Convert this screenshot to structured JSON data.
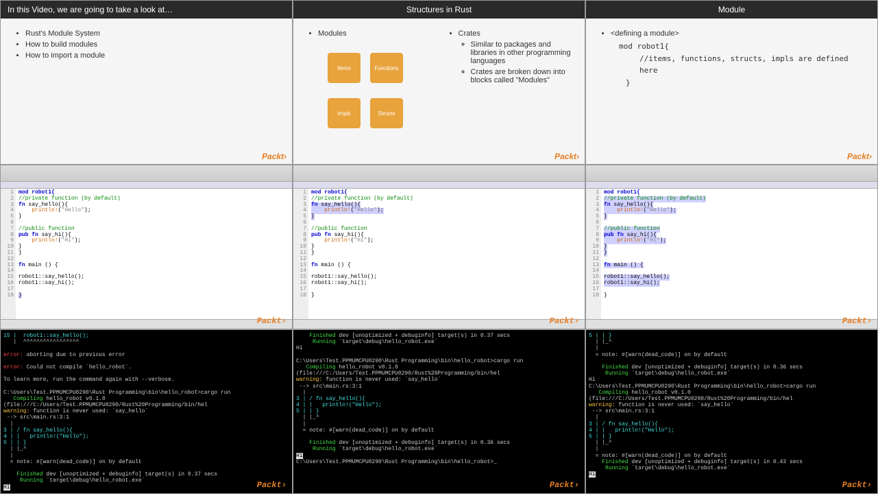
{
  "brand": "Packt›",
  "slide1": {
    "title": "In this Video, we are going to take a look at…",
    "items": [
      "Rust's Module System",
      "How to build modules",
      "How to import a module"
    ]
  },
  "slide2": {
    "title": "Structures in Rust",
    "col1_title": "Modules",
    "boxes": {
      "items": "Items",
      "functions": "Functions",
      "impls": "Impls",
      "structs": "Structs"
    },
    "col2_title": "Crates",
    "crates": [
      "Similar to packages and libraries in other programming languages",
      "Crates are broken down into blocks called \"Modules\""
    ]
  },
  "slide3": {
    "title": "Module",
    "heading": "<defining a module>",
    "line1": "mod robot1{",
    "line2": "//items, functions, structs, impls are defined here",
    "line3": "}"
  },
  "editor_gutter": "1\n2\n3\n4\n5\n6\n7\n8\n9\n10\n11\n12\n13\n14\n15\n16\n17\n18",
  "editor_code": {
    "l1": "mod robot1{",
    "l2": "//private function (by default)",
    "l3": "fn say_hello(){",
    "l4": "    println!(\"Hello\");",
    "l5": "}",
    "l6": "",
    "l7": "//public function",
    "l8": "pub fn say_hi(){",
    "l9": "    println!(\"Hi\");",
    "l10": "}",
    "l11": "}",
    "l12": "",
    "l13": "fn main () {",
    "l14": "",
    "l15": "robot1::say_hello();",
    "l16": "robot1::say_hi();",
    "l17": "",
    "l18": "}"
  },
  "terminal1": {
    "l1": "15 |  robot1::say_hello();",
    "l2": "   |  ^^^^^^^^^^^^^^^^^",
    "l3": "error: aborting due to previous error",
    "l4": "error: Could not compile `hello_robot`.",
    "l5": "To learn more, run the command again with --verbose.",
    "l6": "C:\\Users\\Test.PPMUMCPU0290\\Rust Programming\\bin\\hello_robot>cargo run",
    "l7": "   Compiling hello_robot v0.1.0 (file:///C:/Users/Test.PPMUMCPU0290/Rust%20Programming/bin/hel",
    "l8": "warning: function is never used: `say_hello`",
    "l9": " --> src\\main.rs:3:1",
    "l10": "  |",
    "l11": "3 | / fn say_hello(){",
    "l12": "4 | |   println!(\"Hello\");",
    "l13": "5 | | }",
    "l14": "  | |_^",
    "l15": "  |",
    "l16": "  = note: #[warn(dead_code)] on by default",
    "l17": "    Finished dev [unoptimized + debuginfo] target(s) in 0.37 secs",
    "l18": "     Running `target\\debug\\hello_robot.exe`",
    "l19": "Hi"
  },
  "terminal2": {
    "l1": "    Finished dev [unoptimized + debuginfo] target(s) in 0.37 secs",
    "l2": "     Running `target\\debug\\hello_robot.exe`",
    "l3": "Hi",
    "l4": "",
    "l5": "C:\\Users\\Test.PPMUMCPU0290\\Rust Programming\\bin\\hello_robot>cargo run",
    "l6": "   Compiling hello_robot v0.1.0 (file:///C:/Users/Test.PPMUMCPU0290/Rust%20Programming/bin/hel",
    "l7": "warning: function is never used: `say_hello`",
    "l8": " --> src\\main.rs:3:1",
    "l9": "  |",
    "l10": "3 | / fn say_hello(){",
    "l11": "4 | |   println!(\"Hello\");",
    "l12": "5 | | }",
    "l13": "  | |_^",
    "l14": "  |",
    "l15": "  = note: #[warn(dead_code)] on by default",
    "l16": "    Finished dev [unoptimized + debuginfo] target(s) in 0.36 secs",
    "l17": "     Running `target\\debug\\hello_robot.exe`",
    "l18": "Hi",
    "l19": "C:\\Users\\Test.PPMUMCPU0290\\Rust Programming\\bin\\hello_robot>_"
  },
  "terminal3": {
    "l1": "5 | | }",
    "l2": "  | |_^",
    "l3": "  |",
    "l4": "  = note: #[warn(dead_code)] on by default",
    "l5": "",
    "l6": "    Finished dev [unoptimized + debuginfo] target(s) in 0.36 secs",
    "l7": "     Running `target\\debug\\hello_robot.exe`",
    "l8": "Hi",
    "l9": "C:\\Users\\Test.PPMUMCPU0290\\Rust Programming\\bin\\hello_robot>cargo run",
    "l10": "   Compiling hello_robot v0.1.0 (file:///C:/Users/Test.PPMUMCPU0290/Rust%20Programming/bin/hel",
    "l11": "warning: function is never used: `say_hello`",
    "l12": " --> src\\main.rs:3:1",
    "l13": "  |",
    "l14": "3 | / fn say_hello(){",
    "l15": "4 | |   println!(\"Hello\");",
    "l16": "5 | | }",
    "l17": "  | |_^",
    "l18": "  |",
    "l19": "  = note: #[warn(dead_code)] on by default",
    "l20": "    Finished dev [unoptimized + debuginfo] target(s) in 0.43 secs",
    "l21": "     Running `target\\debug\\hello_robot.exe`",
    "l22": "Hi"
  }
}
